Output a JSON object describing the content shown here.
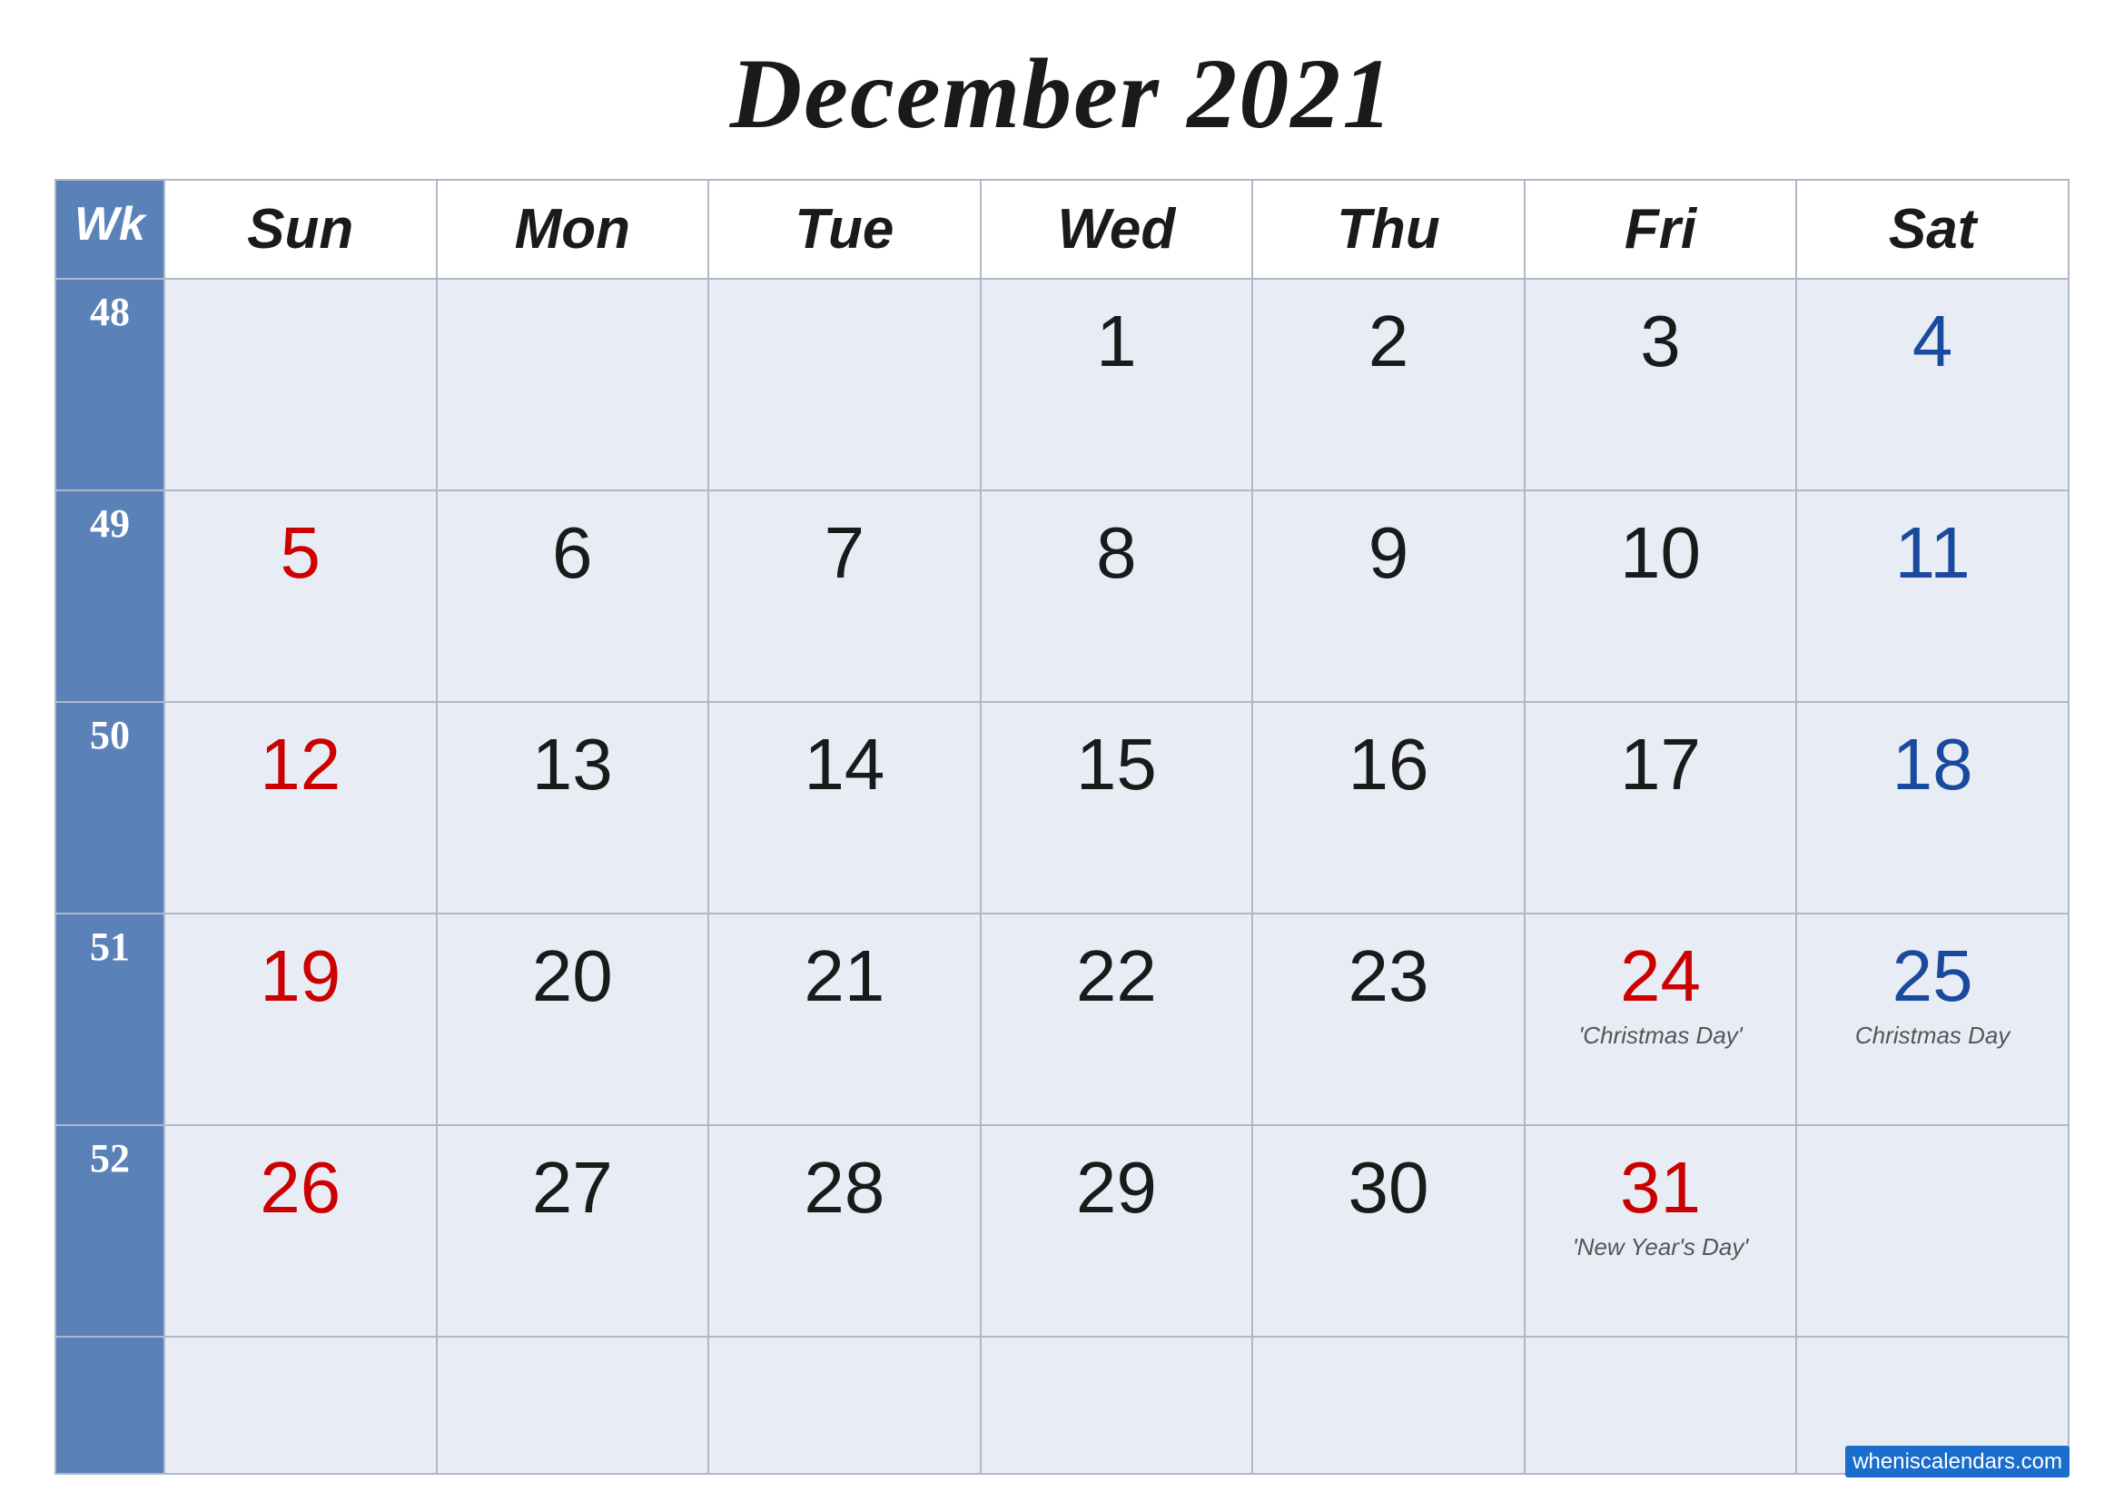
{
  "title": "December 2021",
  "header": {
    "wk": "Wk",
    "days": [
      "Sun",
      "Mon",
      "Tue",
      "Wed",
      "Thu",
      "Fri",
      "Sat"
    ]
  },
  "weeks": [
    {
      "week_num": "48",
      "days": [
        {
          "date": "",
          "type": "empty"
        },
        {
          "date": "",
          "type": "empty"
        },
        {
          "date": "",
          "type": "empty"
        },
        {
          "date": "1",
          "type": "normal"
        },
        {
          "date": "2",
          "type": "normal"
        },
        {
          "date": "3",
          "type": "normal"
        },
        {
          "date": "4",
          "type": "saturday"
        }
      ]
    },
    {
      "week_num": "49",
      "days": [
        {
          "date": "5",
          "type": "sunday"
        },
        {
          "date": "6",
          "type": "normal"
        },
        {
          "date": "7",
          "type": "normal"
        },
        {
          "date": "8",
          "type": "normal"
        },
        {
          "date": "9",
          "type": "normal"
        },
        {
          "date": "10",
          "type": "normal"
        },
        {
          "date": "11",
          "type": "saturday"
        }
      ]
    },
    {
      "week_num": "50",
      "days": [
        {
          "date": "12",
          "type": "sunday"
        },
        {
          "date": "13",
          "type": "normal"
        },
        {
          "date": "14",
          "type": "normal"
        },
        {
          "date": "15",
          "type": "normal"
        },
        {
          "date": "16",
          "type": "normal"
        },
        {
          "date": "17",
          "type": "normal"
        },
        {
          "date": "18",
          "type": "saturday"
        }
      ]
    },
    {
      "week_num": "51",
      "days": [
        {
          "date": "19",
          "type": "sunday"
        },
        {
          "date": "20",
          "type": "normal"
        },
        {
          "date": "21",
          "type": "normal"
        },
        {
          "date": "22",
          "type": "normal"
        },
        {
          "date": "23",
          "type": "normal"
        },
        {
          "date": "24",
          "type": "holiday",
          "holiday": "'Christmas Day'"
        },
        {
          "date": "25",
          "type": "saturday-holiday",
          "holiday": "Christmas Day"
        }
      ]
    },
    {
      "week_num": "52",
      "days": [
        {
          "date": "26",
          "type": "sunday"
        },
        {
          "date": "27",
          "type": "normal"
        },
        {
          "date": "28",
          "type": "normal"
        },
        {
          "date": "29",
          "type": "normal"
        },
        {
          "date": "30",
          "type": "normal"
        },
        {
          "date": "31",
          "type": "holiday",
          "holiday": "'New Year's Day'"
        },
        {
          "date": "",
          "type": "empty"
        }
      ]
    },
    {
      "week_num": "",
      "days": [
        {
          "date": "",
          "type": "empty"
        },
        {
          "date": "",
          "type": "empty"
        },
        {
          "date": "",
          "type": "empty"
        },
        {
          "date": "",
          "type": "empty"
        },
        {
          "date": "",
          "type": "empty"
        },
        {
          "date": "",
          "type": "empty"
        },
        {
          "date": "",
          "type": "empty"
        }
      ]
    }
  ],
  "watermark": "wheniscalendars.com"
}
